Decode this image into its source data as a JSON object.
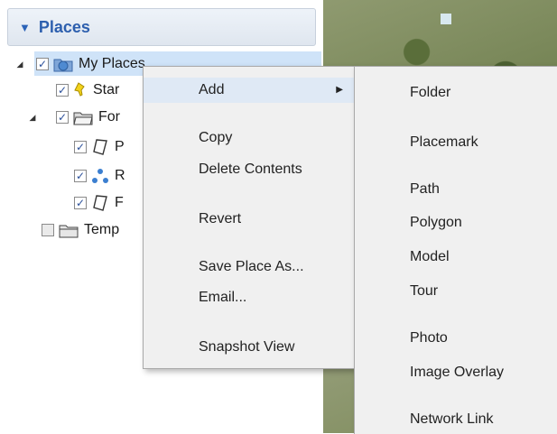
{
  "panel": {
    "title": "Places",
    "items": [
      {
        "label": "My Places",
        "checked": true,
        "icon": "globe-folder-icon"
      },
      {
        "label": "Star",
        "checked": true,
        "icon": "yellow-pushpin-icon"
      },
      {
        "label": "For",
        "checked": true,
        "icon": "open-folder-icon"
      },
      {
        "label": "P",
        "checked": true,
        "icon": "polygon-icon"
      },
      {
        "label": "R",
        "checked": true,
        "icon": "network-dots-icon"
      },
      {
        "label": "F",
        "checked": true,
        "icon": "polygon-icon"
      },
      {
        "label": "Temp",
        "checked": false,
        "icon": "folder-icon"
      }
    ]
  },
  "context_menu": {
    "items": [
      "Add",
      "Copy",
      "Delete Contents",
      "Revert",
      "Save Place As...",
      "Email...",
      "Snapshot View"
    ]
  },
  "submenu": {
    "items": [
      "Folder",
      "Placemark",
      "Path",
      "Polygon",
      "Model",
      "Tour",
      "Photo",
      "Image Overlay",
      "Network Link"
    ]
  },
  "colors": {
    "header_text": "#2d5fae",
    "selection": "#cfe3f8",
    "menu_bg": "#f0f0f0"
  }
}
